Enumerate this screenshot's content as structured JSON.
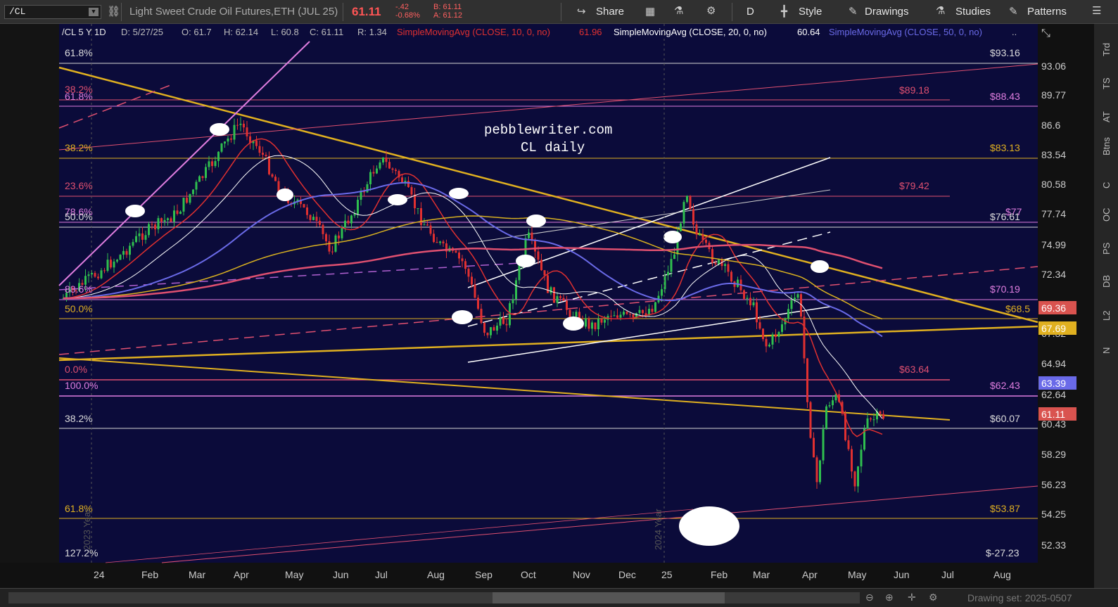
{
  "toolbar": {
    "symbol": "/CL",
    "title": "Light Sweet Crude Oil Futures,ETH (JUL 25)",
    "last": "61.11",
    "change": "-.42",
    "change_pct": "-0.68%",
    "bid": "B: 61.11",
    "ask": "A: 61.12",
    "share": "Share",
    "period": "D",
    "style": "Style",
    "drawings": "Drawings",
    "studies": "Studies",
    "patterns": "Patterns"
  },
  "header": {
    "symbol_period": "/CL 5 Y 1D",
    "date": "D: 5/27/25",
    "open": "O: 61.7",
    "high": "H: 62.14",
    "low": "L: 60.8",
    "close": "C: 61.11",
    "range": "R: 1.34",
    "sma10_label": "SimpleMovingAvg (CLOSE, 10, 0, no)",
    "sma10_value": "61.96",
    "sma20_label": "SimpleMovingAvg (CLOSE, 20, 0, no)",
    "sma20_value": "60.64",
    "sma50_label": "SimpleMovingAvg (CLOSE, 50, 0, no)",
    "more": ".."
  },
  "watermark": {
    "line1": "pebblewriter.com",
    "line2": "CL daily"
  },
  "price_axis": [
    "93.06",
    "89.77",
    "86.6",
    "83.54",
    "80.58",
    "77.74",
    "74.99",
    "72.34",
    "67.32",
    "64.94",
    "62.64",
    "58.29",
    "56.23",
    "54.25",
    "52.33",
    "60.43"
  ],
  "price_tags": [
    {
      "text": "69.36",
      "color": "#d9534f"
    },
    {
      "text": "67.69",
      "color": "#e0b020"
    },
    {
      "text": "63.39",
      "color": "#6a6ae8"
    },
    {
      "text": "61.11",
      "color": "#d9534f"
    }
  ],
  "fib_left": [
    "61.8%",
    "38.2%",
    "61.8%",
    "38.2%",
    "23.6%",
    "78.6%",
    "50.0%",
    "88.6%",
    "50.0%",
    "0.0%",
    "100.0%",
    "38.2%",
    "61.8%",
    "127.2%"
  ],
  "fib_right": [
    "$93.16",
    "$89.18",
    "$88.43",
    "$83.13",
    "$79.42",
    "$77",
    "$76.61",
    "$70.19",
    "$68.5",
    "$63.64",
    "$62.43",
    "$60.07",
    "$53.87",
    "$-27.23"
  ],
  "time_axis": [
    "24",
    "Feb",
    "Mar",
    "Apr",
    "May",
    "Jun",
    "Jul",
    "Aug",
    "Sep",
    "Oct",
    "Nov",
    "Dec",
    "25",
    "Feb",
    "Mar",
    "Apr",
    "May",
    "Jun",
    "Jul",
    "Aug"
  ],
  "year_labels": [
    "2023 Year",
    "2024 Year"
  ],
  "side_tabs": [
    "Trd",
    "TS",
    "AT",
    "Btns",
    "C",
    "OC",
    "PS",
    "DB",
    "L2",
    "N"
  ],
  "bottom": {
    "drawing_set": "Drawing set: 2025-0507"
  },
  "colors": {
    "background": "#0b0b3a",
    "sma10": "#e03030",
    "sma20": "#ffffff",
    "sma50": "#6a6ae8",
    "sma100": "#d8b020",
    "sma200": "#e05070"
  }
}
